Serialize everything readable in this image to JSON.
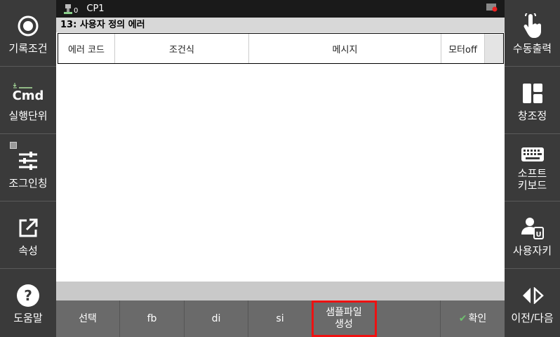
{
  "left_sidebar": [
    {
      "label": "기록조건",
      "icon": "record-circle-icon"
    },
    {
      "label": "실행단위",
      "icon": "cmd-icon",
      "icon_text": "Cmd"
    },
    {
      "label": "조그인칭",
      "icon": "sliders-icon"
    },
    {
      "label": "속성",
      "icon": "external-link-icon"
    },
    {
      "label": "도움말",
      "icon": "help-icon"
    }
  ],
  "right_sidebar": [
    {
      "label": "수동출력",
      "icon": "touch-hand-icon"
    },
    {
      "label": "창조정",
      "icon": "window-layout-icon"
    },
    {
      "label": "소프트\n키보드",
      "icon": "keyboard-icon"
    },
    {
      "label": "사용자키",
      "icon": "user-key-icon"
    },
    {
      "label": "이전/다음",
      "icon": "prev-next-icon"
    }
  ],
  "topbar": {
    "robot_index": "0",
    "title": "CP1"
  },
  "subtitle": "13: 사용자 정의 에러",
  "table": {
    "columns": [
      "에러 코드",
      "조건식",
      "메시지",
      "모터off"
    ]
  },
  "bottom_bar": {
    "buttons": [
      "선택",
      "fb",
      "di",
      "si",
      "샘플파일\n생성",
      "",
      "확인"
    ]
  },
  "colors": {
    "highlight": "#e11111",
    "check": "#6fbf6f"
  }
}
